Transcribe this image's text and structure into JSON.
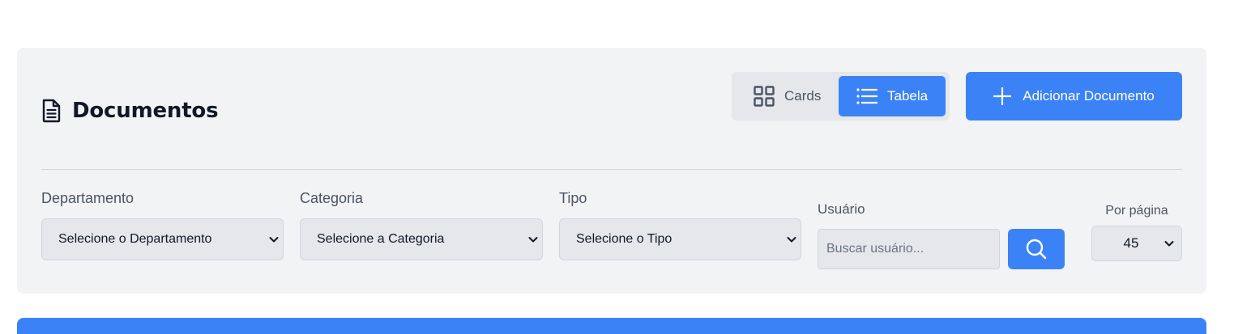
{
  "header": {
    "title": "Documentos",
    "icon": "document-icon"
  },
  "view_toggle": {
    "cards_label": "Cards",
    "table_label": "Tabela",
    "active": "Tabela",
    "cards_icon": "grid-icon",
    "table_icon": "list-icon"
  },
  "add_button": {
    "label": "Adicionar Documento",
    "icon": "plus-icon"
  },
  "filters": {
    "departamento": {
      "label": "Departamento",
      "selected": "Selecione o Departamento"
    },
    "categoria": {
      "label": "Categoria",
      "selected": "Selecione a Categoria"
    },
    "tipo": {
      "label": "Tipo",
      "selected": "Selecione o Tipo"
    },
    "usuario": {
      "label": "Usuário",
      "value": "",
      "placeholder": "Buscar usuário...",
      "search_icon": "search-icon"
    },
    "per_page": {
      "label": "Por página",
      "selected": "45"
    }
  },
  "colors": {
    "accent": "#3b82f6",
    "panel_bg": "#f2f3f5",
    "input_bg": "#e5e7eb",
    "text_dark": "#111827",
    "text_muted": "#4b5563"
  }
}
